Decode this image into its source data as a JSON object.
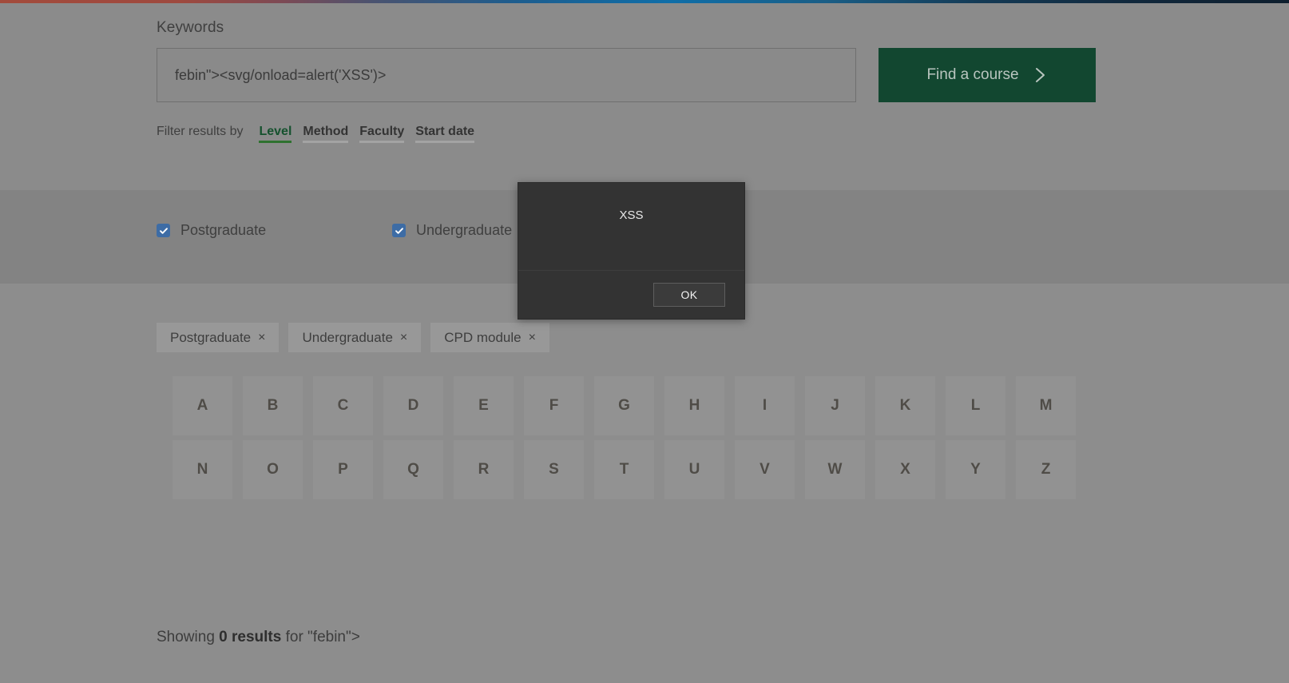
{
  "search": {
    "label": "Keywords",
    "value": "febin\"><svg/onload=alert('XSS')>",
    "placeholder": "Keywords",
    "submit_label": "Find a course",
    "submit_icon": "chevron-right-icon",
    "submit_color": "#124730"
  },
  "filters": {
    "lead": "Filter results by",
    "tabs": [
      {
        "label": "Level",
        "active": true
      },
      {
        "label": "Method",
        "active": false
      },
      {
        "label": "Faculty",
        "active": false
      },
      {
        "label": "Start date",
        "active": false
      }
    ],
    "active_color": "#15512e",
    "active_underline_color": "#2f7230"
  },
  "level_options": [
    {
      "label": "Postgraduate",
      "checked": true
    },
    {
      "label": "Undergraduate",
      "checked": true
    }
  ],
  "selected_chips": [
    {
      "label": "Postgraduate",
      "remove": "×"
    },
    {
      "label": "Undergraduate",
      "remove": "×"
    },
    {
      "label": "CPD module",
      "remove": "×"
    }
  ],
  "alphabet": [
    "A",
    "B",
    "C",
    "D",
    "E",
    "F",
    "G",
    "H",
    "I",
    "J",
    "K",
    "L",
    "M",
    "N",
    "O",
    "P",
    "Q",
    "R",
    "S",
    "T",
    "U",
    "V",
    "W",
    "X",
    "Y",
    "Z"
  ],
  "results": {
    "prefix": "Showing ",
    "count": "0 results",
    "suffix": " for \"febin\">"
  },
  "dialog": {
    "message": "XSS",
    "ok_label": "OK",
    "background": "#333333",
    "text_color": "#e8e8e8"
  },
  "top_strip": {
    "from": "#a24b3c",
    "mid": "#0f6ea8",
    "to": "#0e1f2e"
  }
}
